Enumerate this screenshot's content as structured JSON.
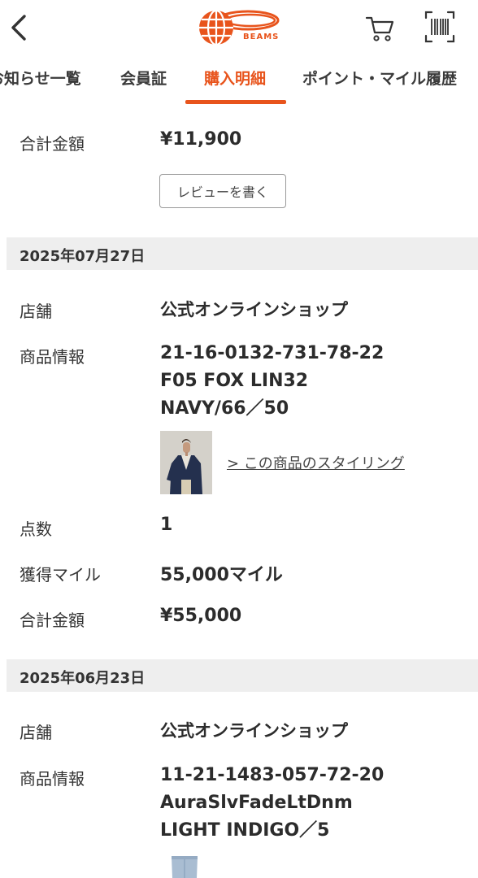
{
  "header": {
    "logo_text": "BEAMS",
    "back_icon": "chevron-left-icon",
    "cart_icon": "cart-icon",
    "barcode_icon": "barcode-scan-icon",
    "accent_color": "#e8541c"
  },
  "tabs": [
    {
      "label": "お知らせ一覧"
    },
    {
      "label": "会員証"
    },
    {
      "label": "購入明細",
      "active": true
    },
    {
      "label": "ポイント・マイル履歴"
    }
  ],
  "top": {
    "total_label": "合計金額",
    "total_value": "¥11,900",
    "review_button": "レビューを書く"
  },
  "orders": [
    {
      "date": "2025年07月27日",
      "store_label": "店舗",
      "store_value": "公式オンラインショップ",
      "product_label": "商品情報",
      "product_lines": [
        "21-16-0132-731-78-22",
        "F05 FOX LIN32",
        "NAVY/66／50"
      ],
      "styling_link": "> この商品のスタイリング",
      "qty_label": "点数",
      "qty_value": "1",
      "miles_label": "獲得マイル",
      "miles_value": "55,000マイル",
      "total_label": "合計金額",
      "total_value": "¥55,000"
    },
    {
      "date": "2025年06月23日",
      "store_label": "店舗",
      "store_value": "公式オンラインショップ",
      "product_label": "商品情報",
      "product_lines": [
        "11-21-1483-057-72-20",
        "AuraSlvFadeLtDnm",
        "LIGHT INDIGO／5"
      ]
    }
  ]
}
